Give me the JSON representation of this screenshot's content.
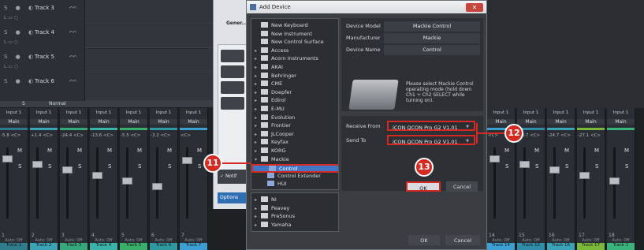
{
  "tracks": [
    {
      "name": "Track 3"
    },
    {
      "name": "Track 4"
    },
    {
      "name": "Track 5"
    },
    {
      "name": "Track 6"
    }
  ],
  "mixer_strip_label": "Normal",
  "mixer_channels_left": [
    {
      "input": "Input 1",
      "output": "Main",
      "pan": "-5.8 <C>",
      "num": "1",
      "auto": "Auto: Off",
      "name": "Track 1",
      "color": "#2f7d8c"
    },
    {
      "input": "Input 1",
      "output": "Main",
      "pan": "+1.4 <C>",
      "num": "2",
      "auto": "Auto: Off",
      "name": "Track 2",
      "color": "#3aa3b6"
    },
    {
      "input": "Input 1",
      "output": "Main",
      "pan": "-24.4 <C>",
      "num": "3",
      "auto": "Auto: Off",
      "name": "Track 3",
      "color": "#35a97c"
    },
    {
      "input": "Input 1",
      "output": "Main",
      "pan": "-13.6 <C>",
      "num": "4",
      "auto": "Auto: Off",
      "name": "Track 4",
      "color": "#3ab4a8"
    },
    {
      "input": "Input 1",
      "output": "Main",
      "pan": "-5.5 <C>",
      "num": "5",
      "auto": "Auto: Off",
      "name": "Track 5",
      "color": "#39b06a"
    },
    {
      "input": "Input 1",
      "output": "Main",
      "pan": "-3.2 <C>",
      "num": "6",
      "auto": "Auto: Off",
      "name": "Track 6",
      "color": "#2e9aa0"
    },
    {
      "input": "Input 1",
      "output": "Main",
      "pan": "<C>",
      "num": "7",
      "auto": "Auto: Off",
      "name": "Track 7",
      "color": "#3b9fd1"
    }
  ],
  "mixer_channels_right": [
    {
      "input": "Input 1",
      "output": "Main",
      "pan": "<C>",
      "num": "14",
      "auto": "Auto: Off",
      "name": "Track 14",
      "color": "#3b9fd1"
    },
    {
      "input": "Input 1",
      "output": "Main",
      "pan": "+8.7 <C>",
      "num": "15",
      "auto": "Auto: Off",
      "name": "Track 15",
      "color": "#2e8ea8"
    },
    {
      "input": "Input 1",
      "output": "Main",
      "pan": "-24.7 <C>",
      "num": "16",
      "auto": "Auto: Off",
      "name": "Track 16",
      "color": "#3aa3b6"
    },
    {
      "input": "Input 1",
      "output": "Main",
      "pan": "-27.1 <C>",
      "num": "17",
      "auto": "Auto: Off",
      "name": "Track 17",
      "color": "#7cb83a"
    },
    {
      "input": "Input 1",
      "output": "Main",
      "pan": "",
      "num": "18",
      "auto": "Auto: Off",
      "name": "Track 1",
      "color": "#3ab47a"
    }
  ],
  "bg_window": {
    "title": "Gener...",
    "notif": "Notif",
    "options": "Options"
  },
  "dialog": {
    "title": "Add Device",
    "device_list": [
      {
        "label": "New Keyboard",
        "type": "item"
      },
      {
        "label": "New Instrument",
        "type": "item"
      },
      {
        "label": "New Control Surface",
        "type": "item"
      },
      {
        "label": "Access",
        "type": "folder"
      },
      {
        "label": "Acorn Instruments",
        "type": "folder"
      },
      {
        "label": "AKAI",
        "type": "folder"
      },
      {
        "label": "Behringer",
        "type": "folder"
      },
      {
        "label": "CME",
        "type": "folder"
      },
      {
        "label": "Doepfer",
        "type": "folder"
      },
      {
        "label": "Edirol",
        "type": "folder"
      },
      {
        "label": "E-MU",
        "type": "folder"
      },
      {
        "label": "Evolution",
        "type": "folder"
      },
      {
        "label": "Frontier",
        "type": "folder"
      },
      {
        "label": "JLCooper",
        "type": "folder"
      },
      {
        "label": "Keyfax",
        "type": "folder"
      },
      {
        "label": "KORG",
        "type": "folder"
      },
      {
        "label": "Mackie",
        "type": "folder-open"
      },
      {
        "label": "Control",
        "type": "sub-selected"
      },
      {
        "label": "Control Extender",
        "type": "sub"
      },
      {
        "label": "HUI",
        "type": "sub"
      }
    ],
    "device_list_lower": [
      {
        "label": "NI",
        "type": "folder"
      },
      {
        "label": "Peavey",
        "type": "folder"
      },
      {
        "label": "PreSonus",
        "type": "folder"
      },
      {
        "label": "Yamaha",
        "type": "folder"
      }
    ],
    "device_model_label": "Device Model",
    "device_model_value": "Mackie Control",
    "manufacturer_label": "Manufacturer",
    "manufacturer_value": "Mackie",
    "device_name_label": "Device Name",
    "device_name_value": "Control",
    "note": "Please select Mackie Control operating mode (hold down Ch1 + Ch2 SELECT while turning on).",
    "receive_from_label": "Receive From",
    "receive_from_value": "iCON QCON Pro G2 V1.01",
    "send_to_label": "Send To",
    "send_to_value": "iCON QCON Pro G2 V1.01",
    "ok_label": "OK",
    "cancel_label": "Cancel",
    "ok2_label": "OK",
    "cancel2_label": "Cancel"
  },
  "callouts": {
    "c11": "11",
    "c12": "12",
    "c13": "13"
  },
  "colors": {
    "highlight": "#d42a22",
    "selection": "#3f78c8"
  }
}
